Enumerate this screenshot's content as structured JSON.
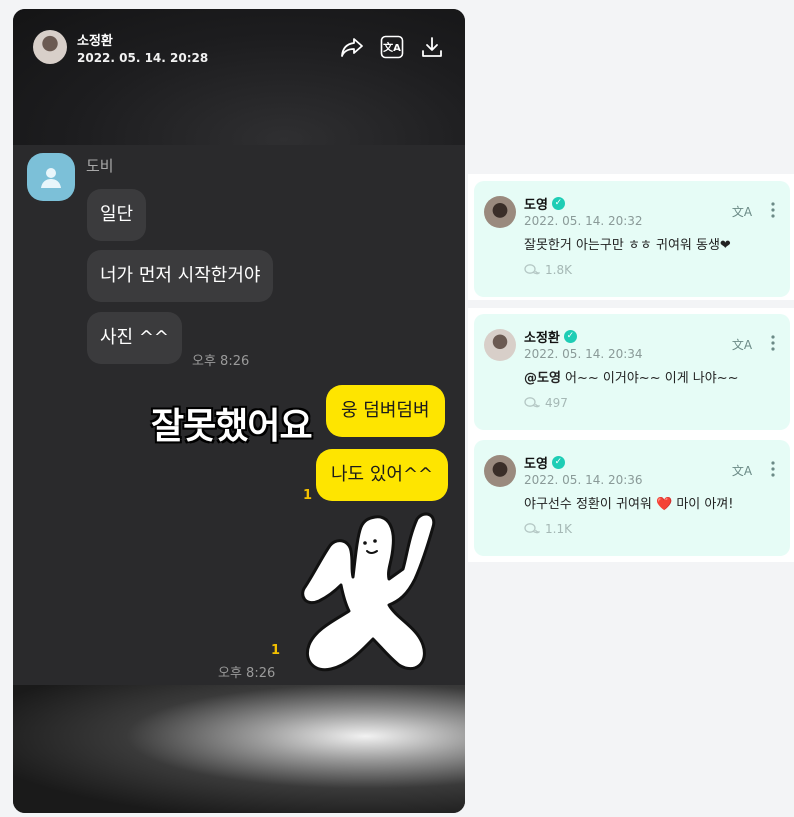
{
  "post": {
    "author": "소정환",
    "date": "2022. 05. 14. 20:28",
    "chat": {
      "sender_name": "도비",
      "messages": [
        "일단",
        "너가 먼저 시작한거야",
        "사진 ^^"
      ],
      "left_time": "오후 8:26",
      "overlay_caption": "잘못했어요",
      "my_messages": [
        "웅 덤벼덤벼",
        "나도 있어^^"
      ],
      "unread_1": "1",
      "unread_2": "1",
      "right_time": "오후 8:26"
    }
  },
  "comments": [
    {
      "name": "도영",
      "date": "2022. 05. 14. 20:32",
      "text": "잘못한거 아는구만 ㅎㅎ 귀여워 동생❤",
      "mention": "",
      "replies": "1.8K"
    },
    {
      "name": "소정환",
      "date": "2022. 05. 14. 20:34",
      "text": " 어~~ 이거야~~ 이게 나야~~",
      "mention": "@도영",
      "replies": "497"
    },
    {
      "name": "도영",
      "date": "2022. 05. 14. 20:36",
      "text": "야구선수 정환이 귀여워 ❤️ 마이 아껴!",
      "mention": "",
      "replies": "1.1K"
    }
  ],
  "icons": {
    "share": "share-icon",
    "translate": "translate-icon",
    "download": "download-icon",
    "more": "more-icon",
    "reply": "reply-icon",
    "verified": "verified-icon"
  },
  "colors": {
    "accent_verified": "#1ecdb5",
    "comment_bg": "#e6fcf6",
    "kakao_yellow": "#fee500"
  }
}
